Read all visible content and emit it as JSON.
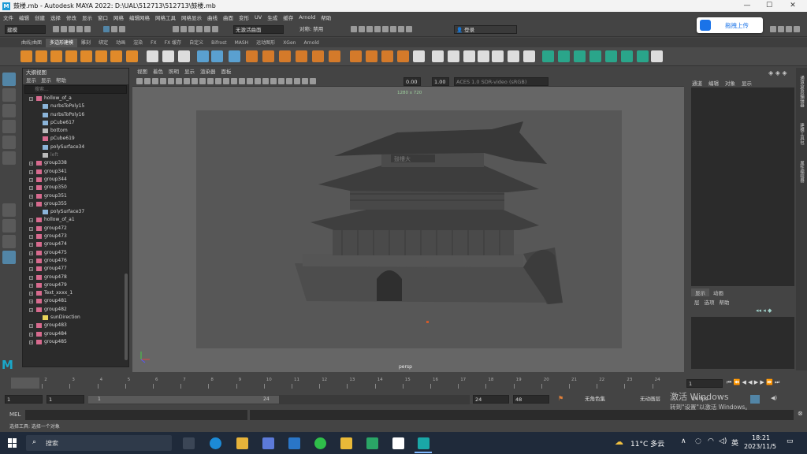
{
  "window": {
    "title": "鼓楼.mb - Autodesk MAYA 2022: D:\\UAL\\512713\\512713\\鼓楼.mb",
    "min": "—",
    "max": "☐",
    "close": "✕"
  },
  "menubar": [
    "文件",
    "编辑",
    "创建",
    "选择",
    "修改",
    "显示",
    "窗口",
    "网格",
    "编辑网格",
    "网格工具",
    "网格显示",
    "曲线",
    "曲面",
    "变形",
    "UV",
    "生成",
    "缓存",
    "Arnold",
    "帮助"
  ],
  "status": {
    "mode": "建模",
    "no_live": "无激活曲面",
    "symmetry": "对称: 禁用",
    "login": "登录"
  },
  "upload_button": "拖拽上传",
  "shelf_tabs": [
    "曲线/曲面",
    "多边形建模",
    "雕刻",
    "绑定",
    "动画",
    "渲染",
    "FX",
    "FX 缓存",
    "自定义",
    "Bifrost",
    "MASH",
    "运动图形",
    "XGen",
    "Arnold"
  ],
  "shelf_active": 1,
  "outliner": {
    "title": "大纲视图",
    "menu": [
      "显示",
      "显示",
      "帮助"
    ],
    "search_placeholder": "搜索...",
    "items": [
      {
        "name": "hollow_of_a",
        "indent": 1,
        "type": "group",
        "exp": true
      },
      {
        "name": "nurbsToPoly15",
        "indent": 2,
        "type": "mesh"
      },
      {
        "name": "nurbsToPoly16",
        "indent": 2,
        "type": "mesh"
      },
      {
        "name": "pCube617",
        "indent": 2,
        "type": "mesh"
      },
      {
        "name": "bottom",
        "indent": 2,
        "type": "cam"
      },
      {
        "name": "pCube619",
        "indent": 2,
        "type": "group"
      },
      {
        "name": "polySurface34",
        "indent": 2,
        "type": "mesh"
      },
      {
        "name": "left",
        "indent": 2,
        "type": "cam",
        "dim": true
      },
      {
        "name": "group338",
        "indent": 1,
        "type": "group",
        "exp": true
      },
      {
        "name": "group341",
        "indent": 1,
        "type": "group",
        "exp": true
      },
      {
        "name": "group344",
        "indent": 1,
        "type": "group",
        "exp": true
      },
      {
        "name": "group350",
        "indent": 1,
        "type": "group",
        "exp": true
      },
      {
        "name": "group351",
        "indent": 1,
        "type": "group",
        "exp": true
      },
      {
        "name": "group355",
        "indent": 1,
        "type": "group",
        "exp": true
      },
      {
        "name": "polySurface37",
        "indent": 2,
        "type": "mesh"
      },
      {
        "name": "hollow_of_a1",
        "indent": 1,
        "type": "group",
        "exp": true
      },
      {
        "name": "group472",
        "indent": 1,
        "type": "group",
        "exp": true
      },
      {
        "name": "group473",
        "indent": 1,
        "type": "group",
        "exp": true
      },
      {
        "name": "group474",
        "indent": 1,
        "type": "group",
        "exp": true
      },
      {
        "name": "group475",
        "indent": 1,
        "type": "group",
        "exp": true
      },
      {
        "name": "group476",
        "indent": 1,
        "type": "group",
        "exp": true
      },
      {
        "name": "group477",
        "indent": 1,
        "type": "group",
        "exp": true
      },
      {
        "name": "group478",
        "indent": 1,
        "type": "group",
        "exp": true
      },
      {
        "name": "group479",
        "indent": 1,
        "type": "group",
        "exp": true
      },
      {
        "name": "Text_xxxx_1",
        "indent": 1,
        "type": "group",
        "exp": true
      },
      {
        "name": "group481",
        "indent": 1,
        "type": "group",
        "exp": true
      },
      {
        "name": "group482",
        "indent": 1,
        "type": "group",
        "exp": true
      },
      {
        "name": "sunDirection",
        "indent": 2,
        "type": "light"
      },
      {
        "name": "group483",
        "indent": 1,
        "type": "group",
        "exp": true
      },
      {
        "name": "group484",
        "indent": 1,
        "type": "group",
        "exp": true
      },
      {
        "name": "group485",
        "indent": 1,
        "type": "group",
        "exp": true
      }
    ]
  },
  "viewport": {
    "menu": [
      "视图",
      "着色",
      "照明",
      "显示",
      "渲染器",
      "面板"
    ],
    "field1": "0.00",
    "field2": "1.00",
    "colorspace": "ACES 1.0 SDR-video (sRGB)",
    "resolution": "1280 x 720",
    "camera": "persp",
    "sign_text": "鼓樓大"
  },
  "channel_box": {
    "menu": [
      "通道",
      "编辑",
      "对象",
      "显示"
    ],
    "tabs": [
      "通道盒/层编辑器",
      "建模工具包",
      "属性编辑器"
    ]
  },
  "layer_editor": {
    "tabs": [
      "显示",
      "动画"
    ],
    "menu": [
      "层",
      "选项",
      "帮助"
    ]
  },
  "time_slider": {
    "ticks": [
      "1",
      "2",
      "3",
      "4",
      "5",
      "6",
      "7",
      "8",
      "9",
      "10",
      "11",
      "12",
      "13",
      "14",
      "15",
      "16",
      "17",
      "18",
      "19",
      "20",
      "21",
      "22",
      "23",
      "24"
    ],
    "current": "1"
  },
  "range": {
    "start": "1",
    "inner_start": "1",
    "inner_end": "24",
    "end": "24",
    "anim_end": "48",
    "char_set": "无角色集",
    "anim_layer": "无动画层",
    "fps": "24 fps"
  },
  "mel": {
    "label": "MEL"
  },
  "help_line": "选择工具: 选择一个对象",
  "activation": {
    "line1": "激活 Windows",
    "line2": "转到\"设置\"以激活 Windows。"
  },
  "taskbar": {
    "search": "搜索",
    "weather": "11°C 多云",
    "lang": "英",
    "time": "18:21",
    "date": "2023/11/5"
  },
  "colors": {
    "maya_bg": "#444444",
    "outliner_bg": "#2b2b2b",
    "viewport_bg": "#666666",
    "select_blue": "#5285a6",
    "upload_blue": "#1a73e8"
  }
}
